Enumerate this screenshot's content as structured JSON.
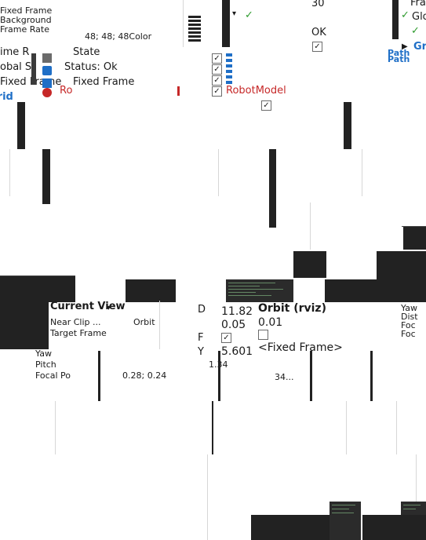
{
  "panel_top_left": {
    "rows": [
      {
        "label": "Fixed Frame",
        "value": ""
      },
      {
        "label": "Background Color",
        "value": "48; 48; 48"
      },
      {
        "label": "Frame Rate",
        "value": "30"
      },
      {
        "label": "Global Status: Ok",
        "value": "OK"
      },
      {
        "label": "Fixed Frame",
        "value": ""
      },
      {
        "label": "Grid",
        "value": ""
      }
    ],
    "right_list": [
      "Fra",
      "Glo",
      "Gri",
      "Path",
      "Path"
    ],
    "displays": [
      {
        "label": "Global Status: Ok",
        "checked": true
      },
      {
        "label": "Fixed Frame",
        "checked": true
      },
      {
        "label": "State",
        "checked": true
      },
      {
        "label": "RobotModel",
        "checked": true
      }
    ],
    "values": {
      "frame_rate": "30",
      "status_ok": "OK"
    }
  },
  "fragments_top": {
    "state": "State",
    "status": "Status: Ok",
    "fixed_frame": "Fixed Frame",
    "robot_model_short": "Ro",
    "robot_model": "RobotModel",
    "grid": "Grid",
    "obal_s": "obal S",
    "ime_r": "ime R",
    "color_vals": "48; 48; 48Color",
    "path": "Path"
  },
  "panel_bottom": {
    "view_title": "Current View",
    "orbit_title": "Orbit (rviz)",
    "rows": [
      {
        "label": "Near Clip ...",
        "value": "0.01"
      },
      {
        "label": "Target Frame",
        "value": "<Fixed Frame>"
      },
      {
        "label": "Distance",
        "value": "11.82"
      },
      {
        "label": "Focal Shape Size",
        "value": "0.05"
      },
      {
        "label": "Focal Shape Fixed",
        "value": "✓"
      },
      {
        "label": "Yaw",
        "value": "5.601"
      },
      {
        "label": "Pitch",
        "value": "1.34"
      },
      {
        "label": "Focal Point",
        "value": "0.28; 0.24"
      }
    ],
    "labels_left": [
      "Yaw",
      "Pitch",
      "Focal Po"
    ],
    "values": {
      "distance": "11.82",
      "focal_size": "0.05",
      "orbit": "Orbit (rviz)",
      "near_clip": "0.01",
      "target": "<Fixed Frame>"
    }
  },
  "colors": {
    "accent_blue": "#1f6fc7",
    "error_red": "#c62828",
    "ok_green": "#2e9b2e",
    "dark": "#222222"
  }
}
